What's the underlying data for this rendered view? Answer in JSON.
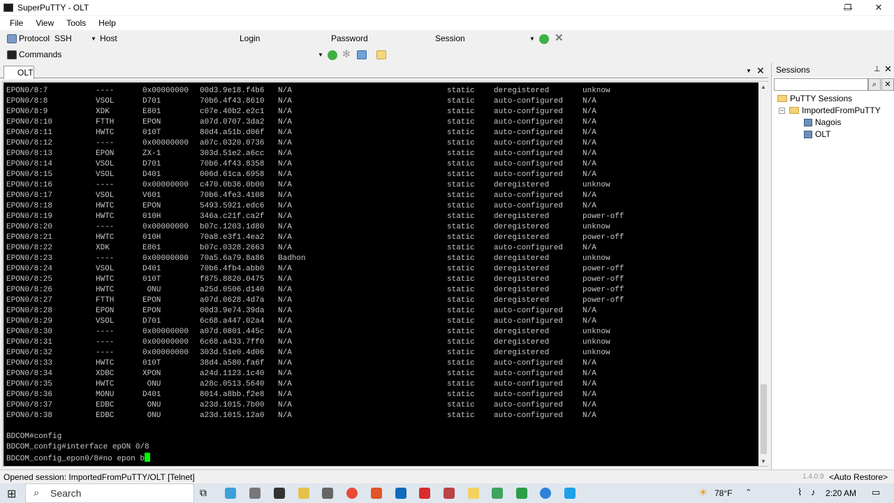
{
  "window": {
    "title": "SuperPuTTY - OLT",
    "controls": {
      "minimize": "—",
      "maximize": "❐",
      "close": "✕"
    }
  },
  "menu": [
    "File",
    "View",
    "Tools",
    "Help"
  ],
  "toolbar": {
    "protocol_label": "Protocol",
    "protocol_value": "SSH",
    "host_label": "Host",
    "login_label": "Login",
    "password_label": "Password",
    "session_label": "Session",
    "commands_label": "Commands"
  },
  "tab": {
    "label": "OLT"
  },
  "terminal": {
    "rows": [
      [
        "EPON0/8:7",
        "----",
        "0x00000000",
        "00d3.9e18.f4b6",
        "N/A",
        "static",
        "deregistered",
        "unknow"
      ],
      [
        "EPON0/8:8",
        "VSOL",
        "D701",
        "70b6.4f43.8610",
        "N/A",
        "static",
        "auto-configured",
        "N/A"
      ],
      [
        "EPON0/8:9",
        "XDK",
        "E801",
        "c07e.40b2.e2c1",
        "N/A",
        "static",
        "auto-configured",
        "N/A"
      ],
      [
        "EPON0/8:10",
        "FTTH",
        "EPON",
        "a07d.0707.3da2",
        "N/A",
        "static",
        "auto-configured",
        "N/A"
      ],
      [
        "EPON0/8:11",
        "HWTC",
        "010T",
        "80d4.a51b.d06f",
        "N/A",
        "static",
        "auto-configured",
        "N/A"
      ],
      [
        "EPON0/8:12",
        "----",
        "0x00000000",
        "a07c.0320.0736",
        "N/A",
        "static",
        "auto-configured",
        "N/A"
      ],
      [
        "EPON0/8:13",
        "EPON",
        "ZX-1",
        "303d.51e2.a6cc",
        "N/A",
        "static",
        "auto-configured",
        "N/A"
      ],
      [
        "EPON0/8:14",
        "VSOL",
        "D701",
        "70b6.4f43.8358",
        "N/A",
        "static",
        "auto-configured",
        "N/A"
      ],
      [
        "EPON0/8:15",
        "VSOL",
        "D401",
        "006d.61ca.6958",
        "N/A",
        "static",
        "auto-configured",
        "N/A"
      ],
      [
        "EPON0/8:16",
        "----",
        "0x00000000",
        "c470.0b36.0b00",
        "N/A",
        "static",
        "deregistered",
        "unknow"
      ],
      [
        "EPON0/8:17",
        "VSOL",
        "V601",
        "70b6.4fe3.4108",
        "N/A",
        "static",
        "auto-configured",
        "N/A"
      ],
      [
        "EPON0/8:18",
        "HWTC",
        "EPON",
        "5493.5921.edc6",
        "N/A",
        "static",
        "auto-configured",
        "N/A"
      ],
      [
        "EPON0/8:19",
        "HWTC",
        "010H",
        "346a.c21f.ca2f",
        "N/A",
        "static",
        "deregistered",
        "power-off"
      ],
      [
        "EPON0/8:20",
        "----",
        "0x00000000",
        "b07c.1203.1d80",
        "N/A",
        "static",
        "deregistered",
        "unknow"
      ],
      [
        "EPON0/8:21",
        "HWTC",
        "010H",
        "70a8.e3f1.4ea2",
        "N/A",
        "static",
        "deregistered",
        "power-off"
      ],
      [
        "EPON0/8:22",
        "XDK",
        "E801",
        "b07c.0328.2663",
        "N/A",
        "static",
        "auto-configured",
        "N/A"
      ],
      [
        "EPON0/8:23",
        "----",
        "0x00000000",
        "70a5.6a79.8a86",
        "Badhon",
        "static",
        "deregistered",
        "unknow"
      ],
      [
        "EPON0/8:24",
        "VSOL",
        "D401",
        "70b6.4fb4.abb0",
        "N/A",
        "static",
        "deregistered",
        "power-off"
      ],
      [
        "EPON0/8:25",
        "HWTC",
        "010T",
        "f875.8820.0475",
        "N/A",
        "static",
        "deregistered",
        "power-off"
      ],
      [
        "EPON0/8:26",
        "HWTC",
        " ONU",
        "a25d.0506.d140",
        "N/A",
        "static",
        "deregistered",
        "power-off"
      ],
      [
        "EPON0/8:27",
        "FTTH",
        "EPON",
        "a07d.0628.4d7a",
        "N/A",
        "static",
        "deregistered",
        "power-off"
      ],
      [
        "EPON0/8:28",
        "EPON",
        "EPON",
        "00d3.9e74.39da",
        "N/A",
        "static",
        "auto-configured",
        "N/A"
      ],
      [
        "EPON0/8:29",
        "VSOL",
        "D701",
        "6c68.a447.02a4",
        "N/A",
        "static",
        "auto-configured",
        "N/A"
      ],
      [
        "EPON0/8:30",
        "----",
        "0x00000000",
        "a07d.0801.445c",
        "N/A",
        "static",
        "deregistered",
        "unknow"
      ],
      [
        "EPON0/8:31",
        "----",
        "0x00000000",
        "6c68.a433.7ff0",
        "N/A",
        "static",
        "deregistered",
        "unknow"
      ],
      [
        "EPON0/8:32",
        "----",
        "0x00000000",
        "303d.51e0.4d06",
        "N/A",
        "static",
        "deregistered",
        "unknow"
      ],
      [
        "EPON0/8:33",
        "HWTC",
        "010T",
        "38d4.a580.fa6f",
        "N/A",
        "static",
        "auto-configured",
        "N/A"
      ],
      [
        "EPON0/8:34",
        "XDBC",
        "XPON",
        "a24d.1123.1c40",
        "N/A",
        "static",
        "auto-configured",
        "N/A"
      ],
      [
        "EPON0/8:35",
        "HWTC",
        " ONU",
        "a28c.0513.5640",
        "N/A",
        "static",
        "auto-configured",
        "N/A"
      ],
      [
        "EPON0/8:36",
        "MONU",
        "D401",
        "8014.a8bb.f2e8",
        "N/A",
        "static",
        "auto-configured",
        "N/A"
      ],
      [
        "EPON0/8:37",
        "EDBC",
        " ONU",
        "a23d.1015.7b00",
        "N/A",
        "static",
        "auto-configured",
        "N/A"
      ],
      [
        "EPON0/8:38",
        "EDBC",
        " ONU",
        "a23d.1015.12a0",
        "N/A",
        "static",
        "auto-configured",
        "N/A"
      ]
    ],
    "prompt_lines": [
      "BDCOM#config",
      "BDCOM_config#interface epON 0/8",
      "BDCOM_config_epon0/8#no epon b"
    ]
  },
  "sessions": {
    "title": "Sessions",
    "root": "PuTTY Sessions",
    "folder": "ImportedFromPuTTY",
    "items": [
      "Nagois",
      "OLT"
    ]
  },
  "statusbar": {
    "message": "Opened session: ImportedFromPuTTY/OLT [Telnet]",
    "version": "1.4.0.9",
    "auto_restore": "<Auto Restore>"
  },
  "taskbar": {
    "search_placeholder": "Search",
    "weather": "78°F",
    "time": "2:20 AM"
  }
}
